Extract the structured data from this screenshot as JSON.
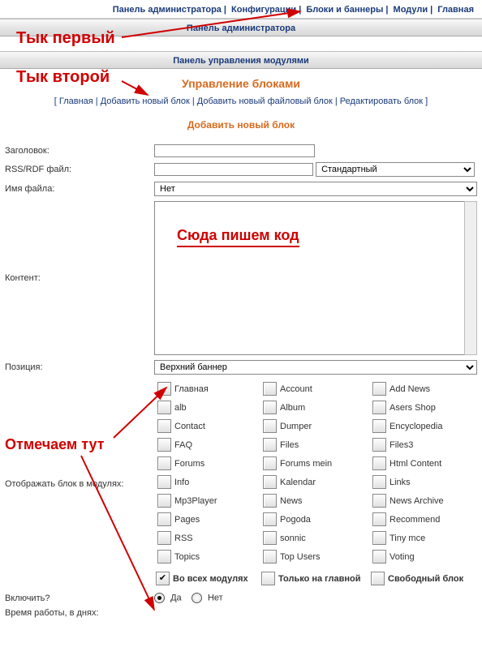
{
  "topnav": {
    "items": [
      "Панель администратора",
      "Конфигурации",
      "Блоки и баннеры",
      "Модули",
      "Главная"
    ]
  },
  "bar1": "Панель администратора",
  "bar2": "Панель управления модулями",
  "orange_title": "Управление блоками",
  "subnav": {
    "home": "Главная",
    "add_block": "Добавить новый блок",
    "add_file_block": "Добавить новый файловый блок",
    "edit_block": "Редактировать блок"
  },
  "orange_mid": "Добавить новый блок",
  "form": {
    "title_label": "Заголовок:",
    "rss_label": "RSS/RDF файл:",
    "rss_select": "Стандартный",
    "filename_label": "Имя файла:",
    "filename_select": "Нет",
    "content_label": "Контент:",
    "position_label": "Позиция:",
    "position_select": "Верхний баннер",
    "showin_label": "Отображать блок в модулях:",
    "enable_label": "Включить?",
    "enable_yes": "Да",
    "enable_no": "Нет",
    "worktime_label": "Время работы, в днях:"
  },
  "modules": [
    [
      "Главная",
      "Account",
      "Add News"
    ],
    [
      "alb",
      "Album",
      "Asers Shop"
    ],
    [
      "Contact",
      "Dumper",
      "Encyclopedia"
    ],
    [
      "FAQ",
      "Files",
      "Files3"
    ],
    [
      "Forums",
      "Forums mein",
      "Html Content"
    ],
    [
      "Info",
      "Kalendar",
      "Links"
    ],
    [
      "Mp3Player",
      "News",
      "News Archive"
    ],
    [
      "Pages",
      "Pogoda",
      "Recommend"
    ],
    [
      "RSS",
      "sonnic",
      "Tiny mce"
    ],
    [
      "Topics",
      "Top Users",
      "Voting"
    ]
  ],
  "module_modes": {
    "all": "Во всех модулях",
    "home": "Только на главной",
    "free": "Свободный блок"
  },
  "annotations": {
    "first": "Тык первый",
    "second": "Тык второй",
    "code_here": "Сюда пишем код",
    "check_here": "Отмечаем тут"
  }
}
